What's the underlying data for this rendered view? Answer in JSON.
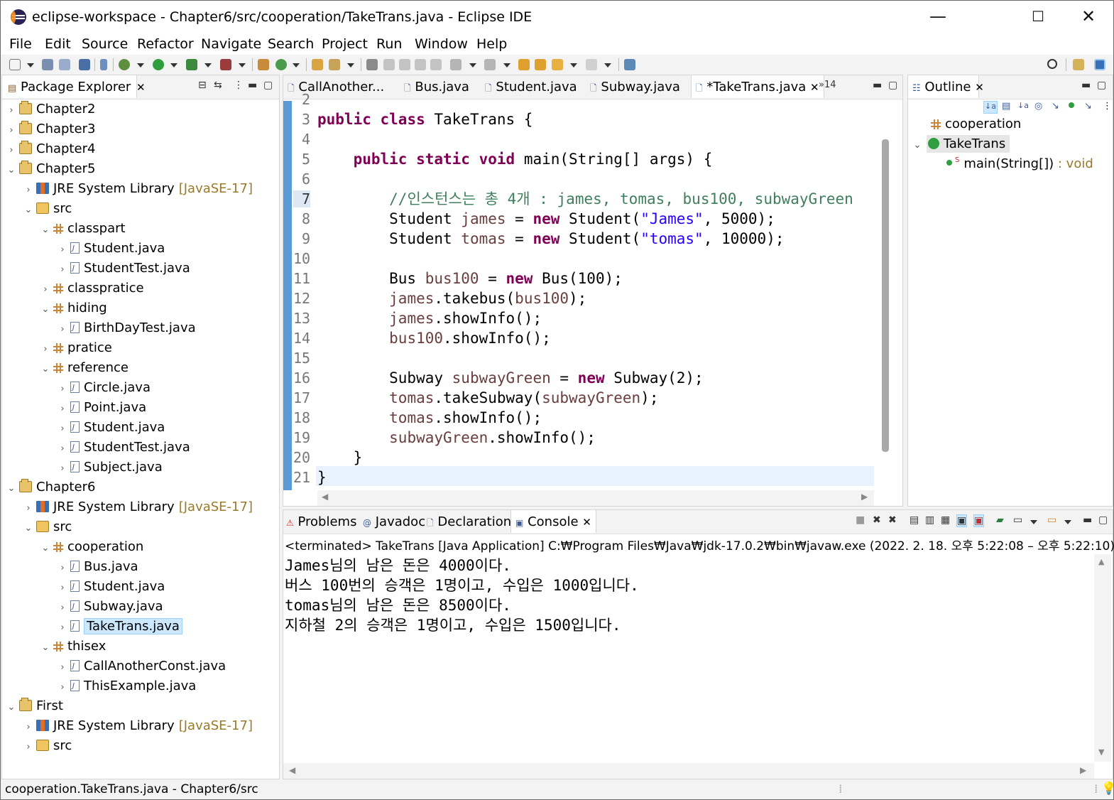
{
  "window": {
    "title": "eclipse-workspace - Chapter6/src/cooperation/TakeTrans.java - Eclipse IDE",
    "minimize": "—",
    "maximize": "☐",
    "close": "✕"
  },
  "menu": [
    "File",
    "Edit",
    "Source",
    "Refactor",
    "Navigate",
    "Search",
    "Project",
    "Run",
    "Window",
    "Help"
  ],
  "package_explorer": {
    "tab": "Package Explorer",
    "rows": [
      {
        "label": "Chapter2",
        "icon": "project-icon"
      },
      {
        "label": "Chapter3",
        "icon": "project-icon"
      },
      {
        "label": "Chapter4",
        "icon": "project-icon"
      },
      {
        "label": "Chapter5",
        "icon": "project-icon"
      },
      {
        "label": "JRE System Library",
        "suffix": "[JavaSE-17]",
        "icon": "library-icon"
      },
      {
        "label": "src",
        "icon": "source-folder-icon"
      },
      {
        "label": "classpart",
        "icon": "package-icon"
      },
      {
        "label": "Student.java",
        "icon": "java-file-icon"
      },
      {
        "label": "StudentTest.java",
        "icon": "java-file-icon"
      },
      {
        "label": "classpratice",
        "icon": "package-icon"
      },
      {
        "label": "hiding",
        "icon": "package-icon"
      },
      {
        "label": "BirthDayTest.java",
        "icon": "java-file-icon"
      },
      {
        "label": "pratice",
        "icon": "package-icon"
      },
      {
        "label": "reference",
        "icon": "package-icon"
      },
      {
        "label": "Circle.java",
        "icon": "java-file-icon"
      },
      {
        "label": "Point.java",
        "icon": "java-file-icon"
      },
      {
        "label": "Student.java",
        "icon": "java-file-icon"
      },
      {
        "label": "StudentTest.java",
        "icon": "java-file-icon"
      },
      {
        "label": "Subject.java",
        "icon": "java-file-icon"
      },
      {
        "label": "Chapter6",
        "icon": "project-icon"
      },
      {
        "label": "JRE System Library",
        "suffix": "[JavaSE-17]",
        "icon": "library-icon"
      },
      {
        "label": "src",
        "icon": "source-folder-icon"
      },
      {
        "label": "cooperation",
        "icon": "package-icon"
      },
      {
        "label": "Bus.java",
        "icon": "java-file-icon"
      },
      {
        "label": "Student.java",
        "icon": "java-file-icon"
      },
      {
        "label": "Subway.java",
        "icon": "java-file-icon"
      },
      {
        "label": "TakeTrans.java",
        "icon": "java-file-icon",
        "selected": true
      },
      {
        "label": "thisex",
        "icon": "package-icon"
      },
      {
        "label": "CallAnotherConst.java",
        "icon": "java-file-icon"
      },
      {
        "label": "ThisExample.java",
        "icon": "java-file-icon"
      },
      {
        "label": "First",
        "icon": "project-icon"
      },
      {
        "label": "JRE System Library",
        "suffix": "[JavaSE-17]",
        "icon": "library-icon"
      },
      {
        "label": "src",
        "icon": "source-folder-icon"
      }
    ]
  },
  "editor": {
    "tabs": [
      "CallAnother...",
      "Bus.java",
      "Student.java",
      "Subway.java",
      "*TakeTrans.java"
    ],
    "overflow": "»14",
    "line_numbers": [
      "2",
      "3",
      "4",
      "5",
      "6",
      "7",
      "8",
      "9",
      "10",
      "11",
      "12",
      "13",
      "14",
      "15",
      "16",
      "17",
      "18",
      "19",
      "20",
      "21"
    ],
    "code": [
      "",
      "public class TakeTrans {",
      "",
      "    public static void main(String[] args) {",
      "",
      "        //인스턴스는 총 4개 : james, tomas, bus100, subwayGreen",
      "        Student james = new Student(\"James\", 5000);",
      "        Student tomas = new Student(\"tomas\", 10000);",
      "",
      "        Bus bus100 = new Bus(100);",
      "        james.takebus(bus100);",
      "        james.showInfo();",
      "        bus100.showInfo();",
      "",
      "        Subway subwayGreen = new Subway(2);",
      "        tomas.takeSubway(subwayGreen);",
      "        tomas.showInfo();",
      "        subwayGreen.showInfo();",
      "    }",
      "}"
    ]
  },
  "outline": {
    "tab": "Outline",
    "package": "cooperation",
    "class": "TakeTrans",
    "method": "main(String[])",
    "method_type": " : void"
  },
  "console": {
    "tabs": [
      "Problems",
      "Javadoc",
      "Declaration",
      "Console"
    ],
    "status": "<terminated> TakeTrans [Java Application] C:₩Program Files₩Java₩jdk-17.0.2₩bin₩javaw.exe  (2022. 2. 18. 오후 5:22:08 – 오후 5:22:10)",
    "output": [
      "James님의 남은 돈은 4000이다.",
      "버스 100번의 승객은 1명이고, 수입은 1000입니다.",
      "tomas님의 남은 돈은 8500이다.",
      "지하철 2의 승객은 1명이고, 수입은 1500입니다."
    ]
  },
  "statusbar": {
    "text": "cooperation.TakeTrans.java - Chapter6/src"
  },
  "colors": {
    "keyword": "#7f0055",
    "string": "#2a00ff",
    "comment": "#3f7f5f",
    "field": "#6a3e3e",
    "selection": "#cce8ff",
    "ruler": "#5b9bd5"
  }
}
